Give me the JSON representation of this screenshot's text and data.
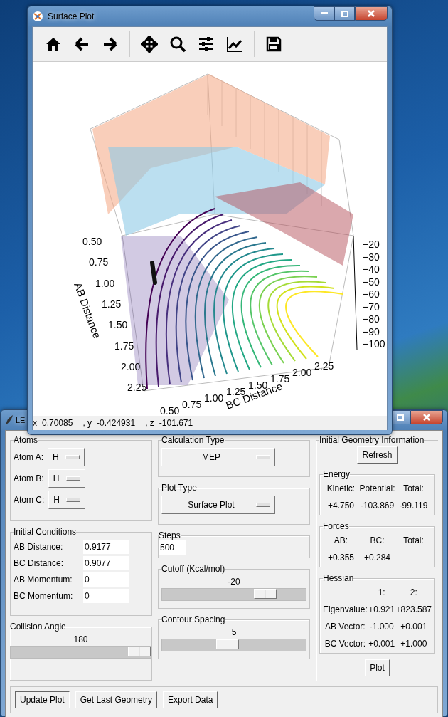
{
  "plot_window": {
    "title": "Surface Plot",
    "plot": {
      "ab_axis": {
        "title": "AB Distance",
        "ticks": [
          "0.50",
          "0.75",
          "1.00",
          "1.25",
          "1.50",
          "1.75",
          "2.00",
          "2.25"
        ]
      },
      "bc_axis": {
        "title": "BC Distance",
        "ticks": [
          "0.50",
          "0.75",
          "1.00",
          "1.25",
          "1.50",
          "1.75",
          "2.00",
          "2.25"
        ]
      },
      "z_axis": {
        "ticks": [
          "−20",
          "−30",
          "−40",
          "−50",
          "−60",
          "−70",
          "−80",
          "−90",
          "−100"
        ]
      }
    },
    "status": [
      "x=0.70085",
      ", y=-0.424931",
      ", z=-101.671"
    ]
  },
  "main_window": {
    "title": "LE",
    "atoms": {
      "title": "Atoms",
      "rows": [
        {
          "label": "Atom A:",
          "value": "H"
        },
        {
          "label": "Atom B:",
          "value": "H"
        },
        {
          "label": "Atom C:",
          "value": "H"
        }
      ]
    },
    "initial_conditions": {
      "title": "Initial Conditions",
      "rows": [
        {
          "label": "AB Distance:",
          "value": "0.9177"
        },
        {
          "label": "BC Distance:",
          "value": "0.9077"
        },
        {
          "label": "AB Momentum:",
          "value": "0"
        },
        {
          "label": "BC Momentum:",
          "value": "0"
        }
      ]
    },
    "collision_angle": {
      "title": "Collision Angle",
      "reading": "180",
      "level": 1
    },
    "calculation_type": {
      "title": "Calculation Type",
      "value": "MEP"
    },
    "plot_type": {
      "title": "Plot Type",
      "value": "Surface Plot"
    },
    "steps": {
      "title": "Steps",
      "value": "500"
    },
    "cutoff": {
      "title": "Cutoff (Kcal/mol)",
      "reading": "-20",
      "level": 0.76
    },
    "contour_spacing": {
      "title": "Contour Spacing",
      "reading": "5",
      "level": 0.45
    },
    "geometry": {
      "title": "Initial Geometry Information",
      "refresh": "Refresh",
      "energy": {
        "title": "Energy",
        "labels": [
          "Kinetic:",
          "Potential:",
          "Total:"
        ],
        "values": [
          "+4.750",
          "-103.869",
          "-99.119"
        ]
      },
      "forces": {
        "title": "Forces",
        "labels": [
          "AB:",
          "BC:",
          "Total:"
        ],
        "values": [
          "+0.355",
          "+0.284"
        ]
      },
      "hessian": {
        "title": "Hessian",
        "columns": [
          "1:",
          "2:"
        ],
        "rows": [
          {
            "label": "Eigenvalue:",
            "values": [
              "+0.921",
              "+823.587"
            ]
          },
          {
            "label": "AB Vector:",
            "values": [
              "-1.000",
              "+0.001"
            ]
          },
          {
            "label": "BC Vector:",
            "values": [
              "+0.001",
              "+1.000"
            ]
          }
        ]
      },
      "plot": "Plot"
    },
    "buttons": [
      {
        "label": "Update Plot",
        "pressed": true
      },
      {
        "label": "Get Last Geometry",
        "pressed": false
      },
      {
        "label": "Export Data",
        "pressed": false
      }
    ]
  }
}
